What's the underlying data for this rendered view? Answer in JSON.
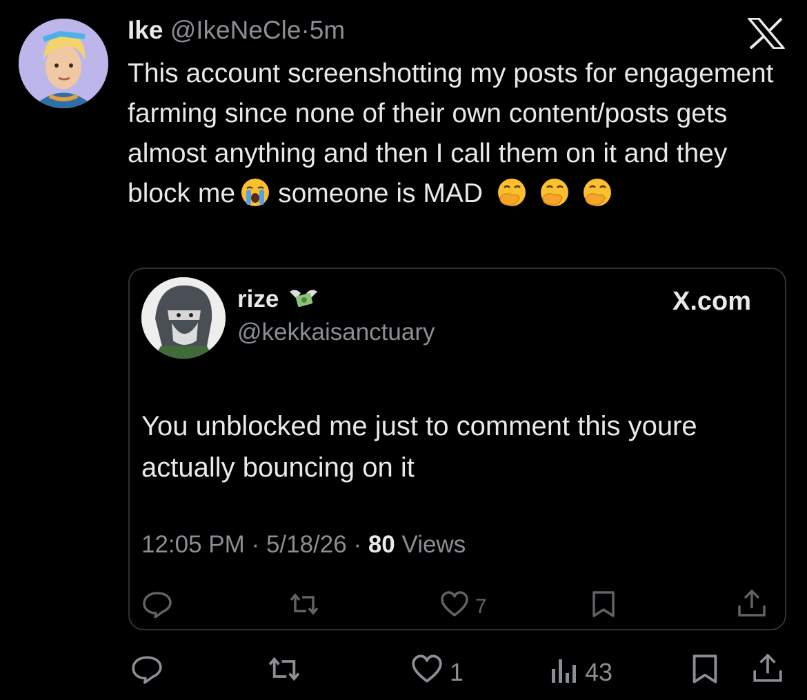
{
  "post": {
    "author_name": "Ike",
    "author_handle": "@IkeNeCle",
    "separator": "·",
    "time": "5m",
    "text_part1": "This account screenshotting my posts for engagement farming since none of their own content/posts gets almost anything and then I call them on it and they block me",
    "text_part2": "someone is MAD",
    "actions": {
      "reply": "",
      "repost": "",
      "likes": "1",
      "views": "43"
    }
  },
  "quoted": {
    "author_name": "rize",
    "author_handle": "@kekkaisanctuary",
    "source": "X.com",
    "text": "You unblocked me just to comment this youre actually bouncing on it",
    "time": "12:05 PM",
    "date": "5/18/26",
    "views_count": "80",
    "views_label": "Views",
    "separator": "·",
    "likes": "7"
  },
  "icons": {
    "app_logo": "x-logo-icon",
    "emoji_1": "loudly-crying-face",
    "emoji_2": "face-with-hand-over-mouth",
    "name_badge": "money-with-wings"
  },
  "colors": {
    "background": "#000000",
    "text": "#e7e9ea",
    "secondary": "#8b8f95",
    "border": "#2f3336"
  }
}
